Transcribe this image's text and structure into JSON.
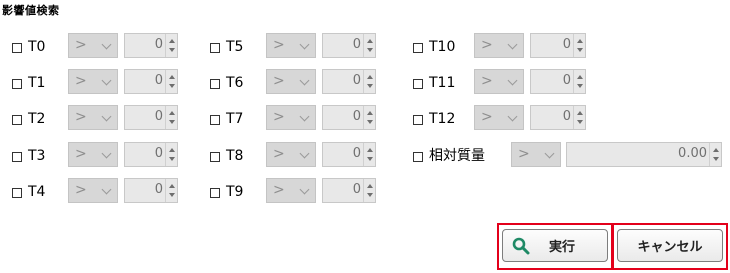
{
  "panel": {
    "title": "影響値検索"
  },
  "rows": {
    "col1": [
      {
        "label": "T0",
        "operator": ">",
        "value": "0"
      },
      {
        "label": "T1",
        "operator": ">",
        "value": "0"
      },
      {
        "label": "T2",
        "operator": ">",
        "value": "0"
      },
      {
        "label": "T3",
        "operator": ">",
        "value": "0"
      },
      {
        "label": "T4",
        "operator": ">",
        "value": "0"
      }
    ],
    "col2": [
      {
        "label": "T5",
        "operator": ">",
        "value": "0"
      },
      {
        "label": "T6",
        "operator": ">",
        "value": "0"
      },
      {
        "label": "T7",
        "operator": ">",
        "value": "0"
      },
      {
        "label": "T8",
        "operator": ">",
        "value": "0"
      },
      {
        "label": "T9",
        "operator": ">",
        "value": "0"
      }
    ],
    "col3": [
      {
        "label": "T10",
        "operator": ">",
        "value": "0"
      },
      {
        "label": "T11",
        "operator": ">",
        "value": "0"
      },
      {
        "label": "T12",
        "operator": ">",
        "value": "0"
      }
    ],
    "mass": {
      "label": "相対質量",
      "operator": ">",
      "value": "0.00"
    }
  },
  "buttons": {
    "execute": "実行",
    "cancel": "キャンセル"
  },
  "colors": {
    "highlight": "#e3001b",
    "search_icon": "#1f8a66"
  }
}
